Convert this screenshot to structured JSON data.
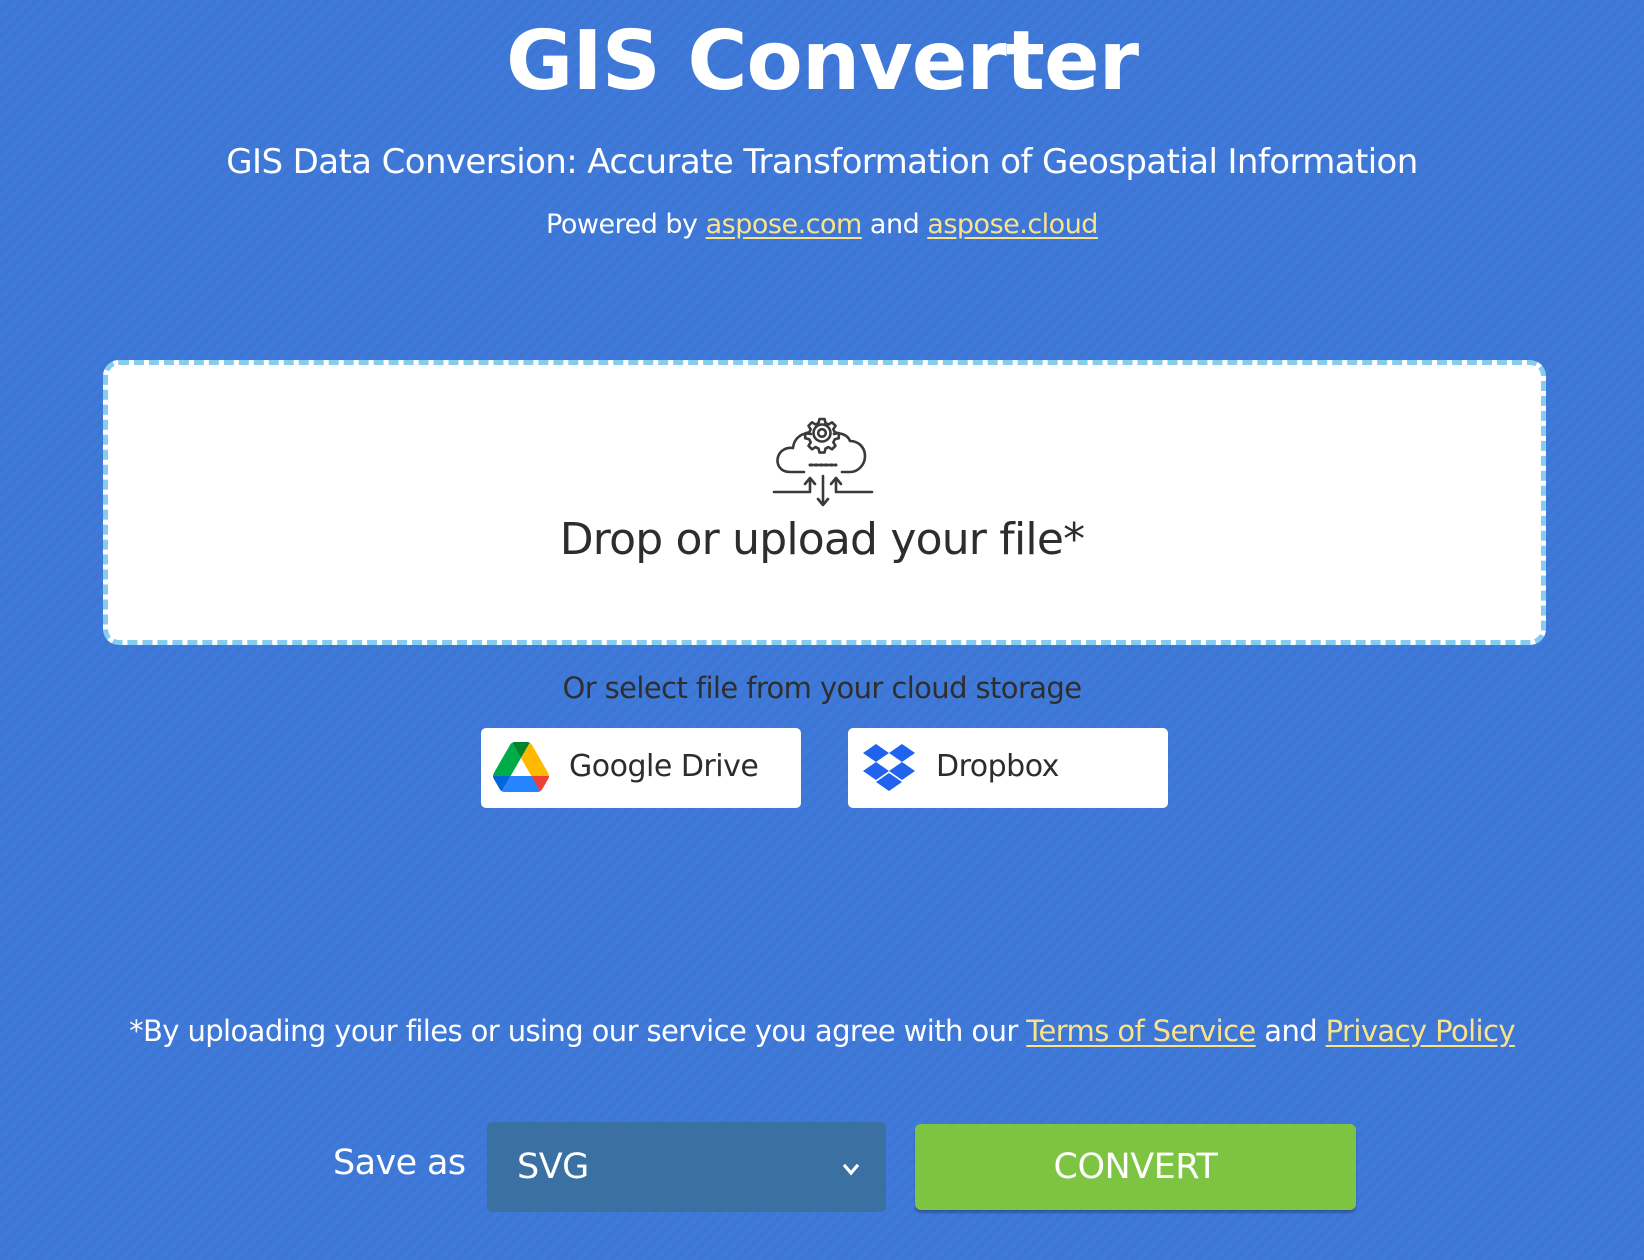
{
  "header": {
    "title": "GIS Converter",
    "subtitle": "GIS Data Conversion: Accurate Transformation of Geospatial Information",
    "powered_prefix": "Powered by ",
    "powered_link1": "aspose.com",
    "powered_and": " and ",
    "powered_link2": "aspose.cloud"
  },
  "dropzone": {
    "icon": "cloud-gear-upload-icon",
    "text": "Drop or upload your file*"
  },
  "cloud_storage": {
    "prompt": "Or select file from your cloud storage",
    "buttons": [
      {
        "label": "Google Drive",
        "icon": "google-drive-icon"
      },
      {
        "label": "Dropbox",
        "icon": "dropbox-icon"
      }
    ]
  },
  "terms": {
    "prefix": "*By uploading your files or using our service you agree with our ",
    "tos_link": "Terms of Service",
    "and": " and ",
    "privacy_link": "Privacy Policy"
  },
  "save": {
    "label": "Save as",
    "selected_format": "SVG",
    "convert_label": "CONVERT"
  },
  "colors": {
    "background": "#3F7ADB",
    "link": "#FCE38A",
    "dropzone_border": "#86CBF0",
    "select_bg": "#3A70A2",
    "convert_bg": "#7DC443"
  }
}
